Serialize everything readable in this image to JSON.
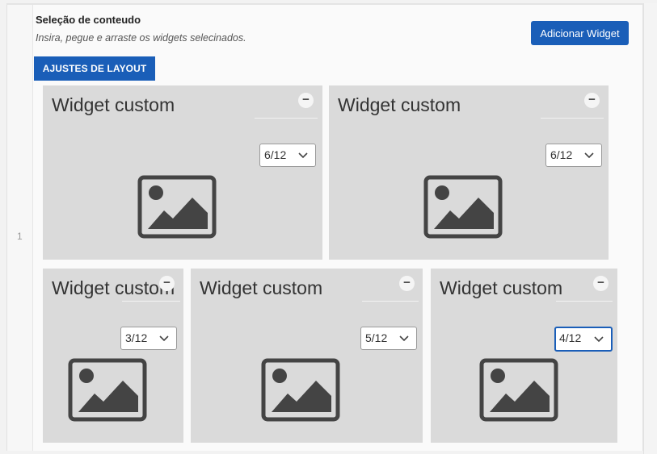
{
  "row_number": "1",
  "header": {
    "title": "Seleção de conteudo",
    "subtitle": "Insira, pegue e arraste os widgets selecinados."
  },
  "buttons": {
    "add_widget": "Adicionar Widget",
    "layout_settings": "AJUSTES DE LAYOUT"
  },
  "widgets": [
    {
      "title": "Widget custom",
      "remove_label": "−",
      "size": "6/12"
    },
    {
      "title": "Widget custom",
      "remove_label": "−",
      "size": "6/12"
    },
    {
      "title": "Widget custom",
      "remove_label": "−",
      "size": "3/12"
    },
    {
      "title": "Widget custom",
      "remove_label": "−",
      "size": "5/12"
    },
    {
      "title": "Widget custom",
      "remove_label": "−",
      "size": "4/12",
      "focused": true
    }
  ],
  "icons": {
    "remove": "minus-circle-icon",
    "dropdown": "chevron-down-icon",
    "placeholder": "image-icon"
  },
  "colors": {
    "accent": "#1a5eb8",
    "widget_bg": "#dadada",
    "icon": "#444444"
  }
}
